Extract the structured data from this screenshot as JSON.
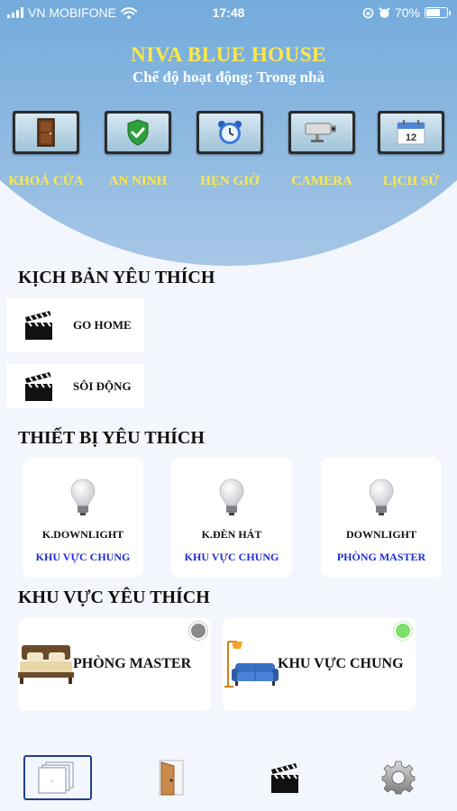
{
  "status_bar": {
    "carrier": "VN MOBIFONE",
    "time": "17:48",
    "battery": "70%",
    "battery_level": 0.7
  },
  "header": {
    "title": "NIVA BLUE HOUSE",
    "mode": "Chế độ hoạt động: Trong nhà",
    "quick_actions": [
      {
        "label": "KHOÁ CỬA",
        "icon": "door-icon"
      },
      {
        "label": "AN NINH",
        "icon": "shield-check-icon"
      },
      {
        "label": "HẸN GIỜ",
        "icon": "alarm-clock-icon"
      },
      {
        "label": "CAMERA",
        "icon": "camera-icon"
      },
      {
        "label": "LỊCH SỬ",
        "icon": "calendar-icon",
        "calendar_day": "12"
      }
    ]
  },
  "favorite_scenes": {
    "title": "KỊCH BẢN YÊU THÍCH",
    "items": [
      {
        "label": "GO HOME",
        "icon": "clapperboard-icon"
      },
      {
        "label": "SÔI ĐỘNG",
        "icon": "clapperboard-icon"
      }
    ]
  },
  "favorite_devices": {
    "title": "THIẾT BỊ YÊU THÍCH",
    "items": [
      {
        "name": "K.DOWNLIGHT",
        "area": "KHU VỰC CHUNG",
        "icon": "light-bulb-icon"
      },
      {
        "name": "K.ĐÈN HÁT",
        "area": "KHU VỰC CHUNG",
        "icon": "light-bulb-icon"
      },
      {
        "name": "DOWNLIGHT",
        "area": "PHÒNG MASTER",
        "icon": "light-bulb-icon"
      }
    ]
  },
  "favorite_areas": {
    "title": "KHU VỰC YÊU THÍCH",
    "items": [
      {
        "name": "PHÒNG MASTER",
        "icon": "bed-icon",
        "status": "off",
        "status_color": "#8a8a8a"
      },
      {
        "name": "KHU VỰC CHUNG",
        "icon": "sofa-lamp-icon",
        "status": "on",
        "status_color": "#7ee06a"
      }
    ]
  },
  "tab_bar": {
    "tabs": [
      {
        "icon": "home-rooms-icon",
        "active": true
      },
      {
        "icon": "door-icon",
        "active": false
      },
      {
        "icon": "clapperboard-icon",
        "active": false
      },
      {
        "icon": "gear-icon",
        "active": false
      }
    ]
  },
  "colors": {
    "header_gradient_top": "#3f8fd6",
    "title_yellow": "#ffe84a",
    "area_text_blue": "#1e2bd4",
    "background": "#f3f6fc"
  }
}
